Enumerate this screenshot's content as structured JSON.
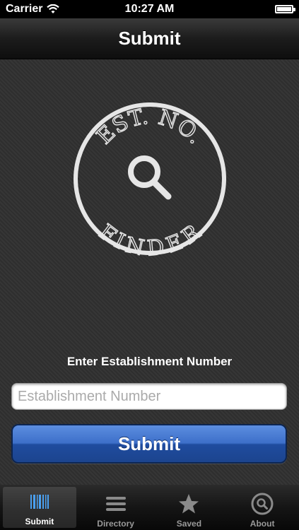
{
  "status_bar": {
    "carrier": "Carrier",
    "time": "10:27 AM",
    "battery_level": 1.0
  },
  "nav": {
    "title": "Submit"
  },
  "logo": {
    "top_text": "EST. NO.",
    "bottom_text": "FINDER",
    "icon": "magnifying-glass-icon"
  },
  "form": {
    "prompt": "Enter Establishment Number",
    "input_value": "",
    "input_placeholder": "Establishment Number",
    "submit_label": "Submit"
  },
  "tabs": [
    {
      "label": "Submit",
      "icon": "barcode-icon",
      "active": true
    },
    {
      "label": "Directory",
      "icon": "list-icon",
      "active": false
    },
    {
      "label": "Saved",
      "icon": "star-icon",
      "active": false
    },
    {
      "label": "About",
      "icon": "search-circle-icon",
      "active": false
    }
  ],
  "colors": {
    "accent_blue": "#3d6fc9",
    "background": "#2b2b2b"
  }
}
